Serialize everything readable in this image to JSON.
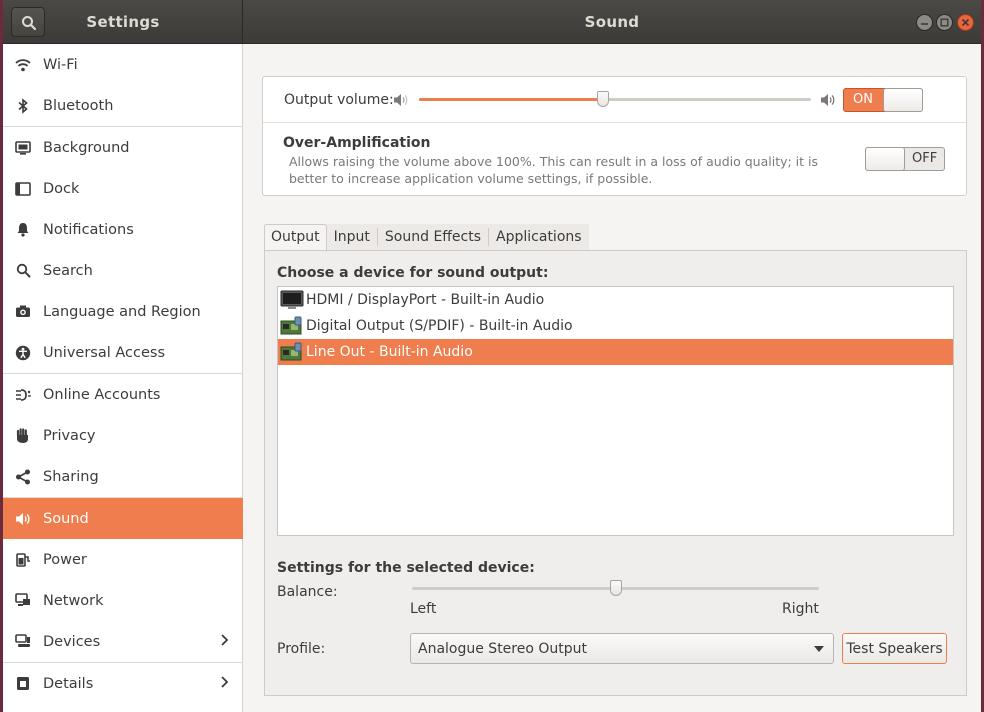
{
  "window": {
    "sidebar_title": "Settings",
    "title": "Sound"
  },
  "sidebar": {
    "items": [
      {
        "label": "Wi-Fi",
        "icon": "wifi-icon"
      },
      {
        "label": "Bluetooth",
        "icon": "bluetooth-icon"
      },
      {
        "label": "Background",
        "icon": "background-icon"
      },
      {
        "label": "Dock",
        "icon": "dock-icon"
      },
      {
        "label": "Notifications",
        "icon": "bell-icon"
      },
      {
        "label": "Search",
        "icon": "search-icon"
      },
      {
        "label": "Language and Region",
        "icon": "camera-icon"
      },
      {
        "label": "Universal Access",
        "icon": "accessibility-icon"
      },
      {
        "label": "Online Accounts",
        "icon": "online-accounts-icon"
      },
      {
        "label": "Privacy",
        "icon": "hand-icon"
      },
      {
        "label": "Sharing",
        "icon": "share-icon"
      },
      {
        "label": "Sound",
        "icon": "speaker-icon",
        "selected": true
      },
      {
        "label": "Power",
        "icon": "power-plug-icon"
      },
      {
        "label": "Network",
        "icon": "network-icon"
      },
      {
        "label": "Devices",
        "icon": "devices-icon",
        "has_submenu": true
      },
      {
        "label": "Details",
        "icon": "details-icon",
        "has_submenu": true
      }
    ]
  },
  "volume": {
    "label": "Output volume:",
    "level": 0.47,
    "switch_label": "ON",
    "switch_state": true
  },
  "amplification": {
    "title": "Over-Amplification",
    "description": "Allows raising the volume above 100%. This can result in a loss of audio quality; it is better to increase application volume settings, if possible.",
    "switch_label": "OFF",
    "switch_state": false
  },
  "tabs": [
    {
      "label": "Output",
      "active": true
    },
    {
      "label": "Input"
    },
    {
      "label": "Sound Effects"
    },
    {
      "label": "Applications"
    }
  ],
  "output": {
    "choose_label": "Choose a device for sound output:",
    "devices": [
      {
        "label": "HDMI / DisplayPort - Built-in Audio",
        "icon": "monitor-icon"
      },
      {
        "label": "Digital Output (S/PDIF) - Built-in Audio",
        "icon": "sound-card-icon"
      },
      {
        "label": "Line Out - Built-in Audio",
        "icon": "sound-card-icon",
        "selected": true
      }
    ],
    "settings_label": "Settings for the selected device:",
    "balance_label": "Balance:",
    "balance_value": 0.5,
    "balance_left": "Left",
    "balance_right": "Right",
    "profile_label": "Profile:",
    "profile_value": "Analogue Stereo Output",
    "test_button": "Test Speakers"
  },
  "colors": {
    "accent": "#ef7d4d",
    "headerbar": "#3c3b37",
    "close_button": "#e9653b"
  }
}
